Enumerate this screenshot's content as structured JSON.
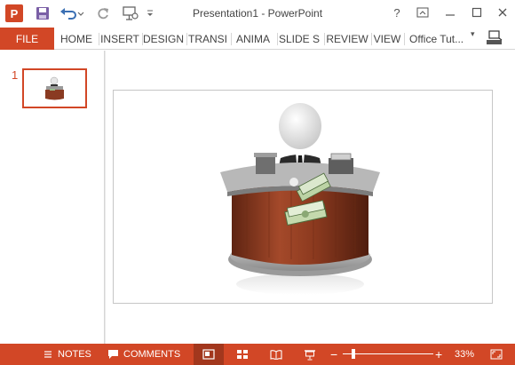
{
  "window": {
    "title": "Presentation1 - PowerPoint",
    "app_logo_letter": "P",
    "help_glyph": "?",
    "controls": [
      "restore-ribbon",
      "minimize",
      "maximize",
      "close"
    ]
  },
  "quick_access": [
    "save-icon",
    "undo-icon",
    "redo-icon",
    "present-icon",
    "customize-icon"
  ],
  "ribbon": {
    "file_label": "FILE",
    "tabs": [
      "HOME",
      "INSERT",
      "DESIGN",
      "TRANSI",
      "ANIMA",
      "SLIDE S",
      "REVIEW",
      "VIEW"
    ],
    "account_name": "Office Tut...",
    "account_caret": "▾"
  },
  "thumbnails": [
    {
      "number": "1"
    }
  ],
  "slide": {
    "image_description": "3D figure at a wooden teller counter with money"
  },
  "status_bar": {
    "notes_label": "NOTES",
    "comments_label": "COMMENTS",
    "zoom_minus": "−",
    "zoom_plus": "+",
    "zoom_percent": "33%",
    "zoom_fraction": 0.33
  },
  "colors": {
    "accent": "#d24726",
    "accent_dark": "#a2371d",
    "text": "#444444"
  }
}
